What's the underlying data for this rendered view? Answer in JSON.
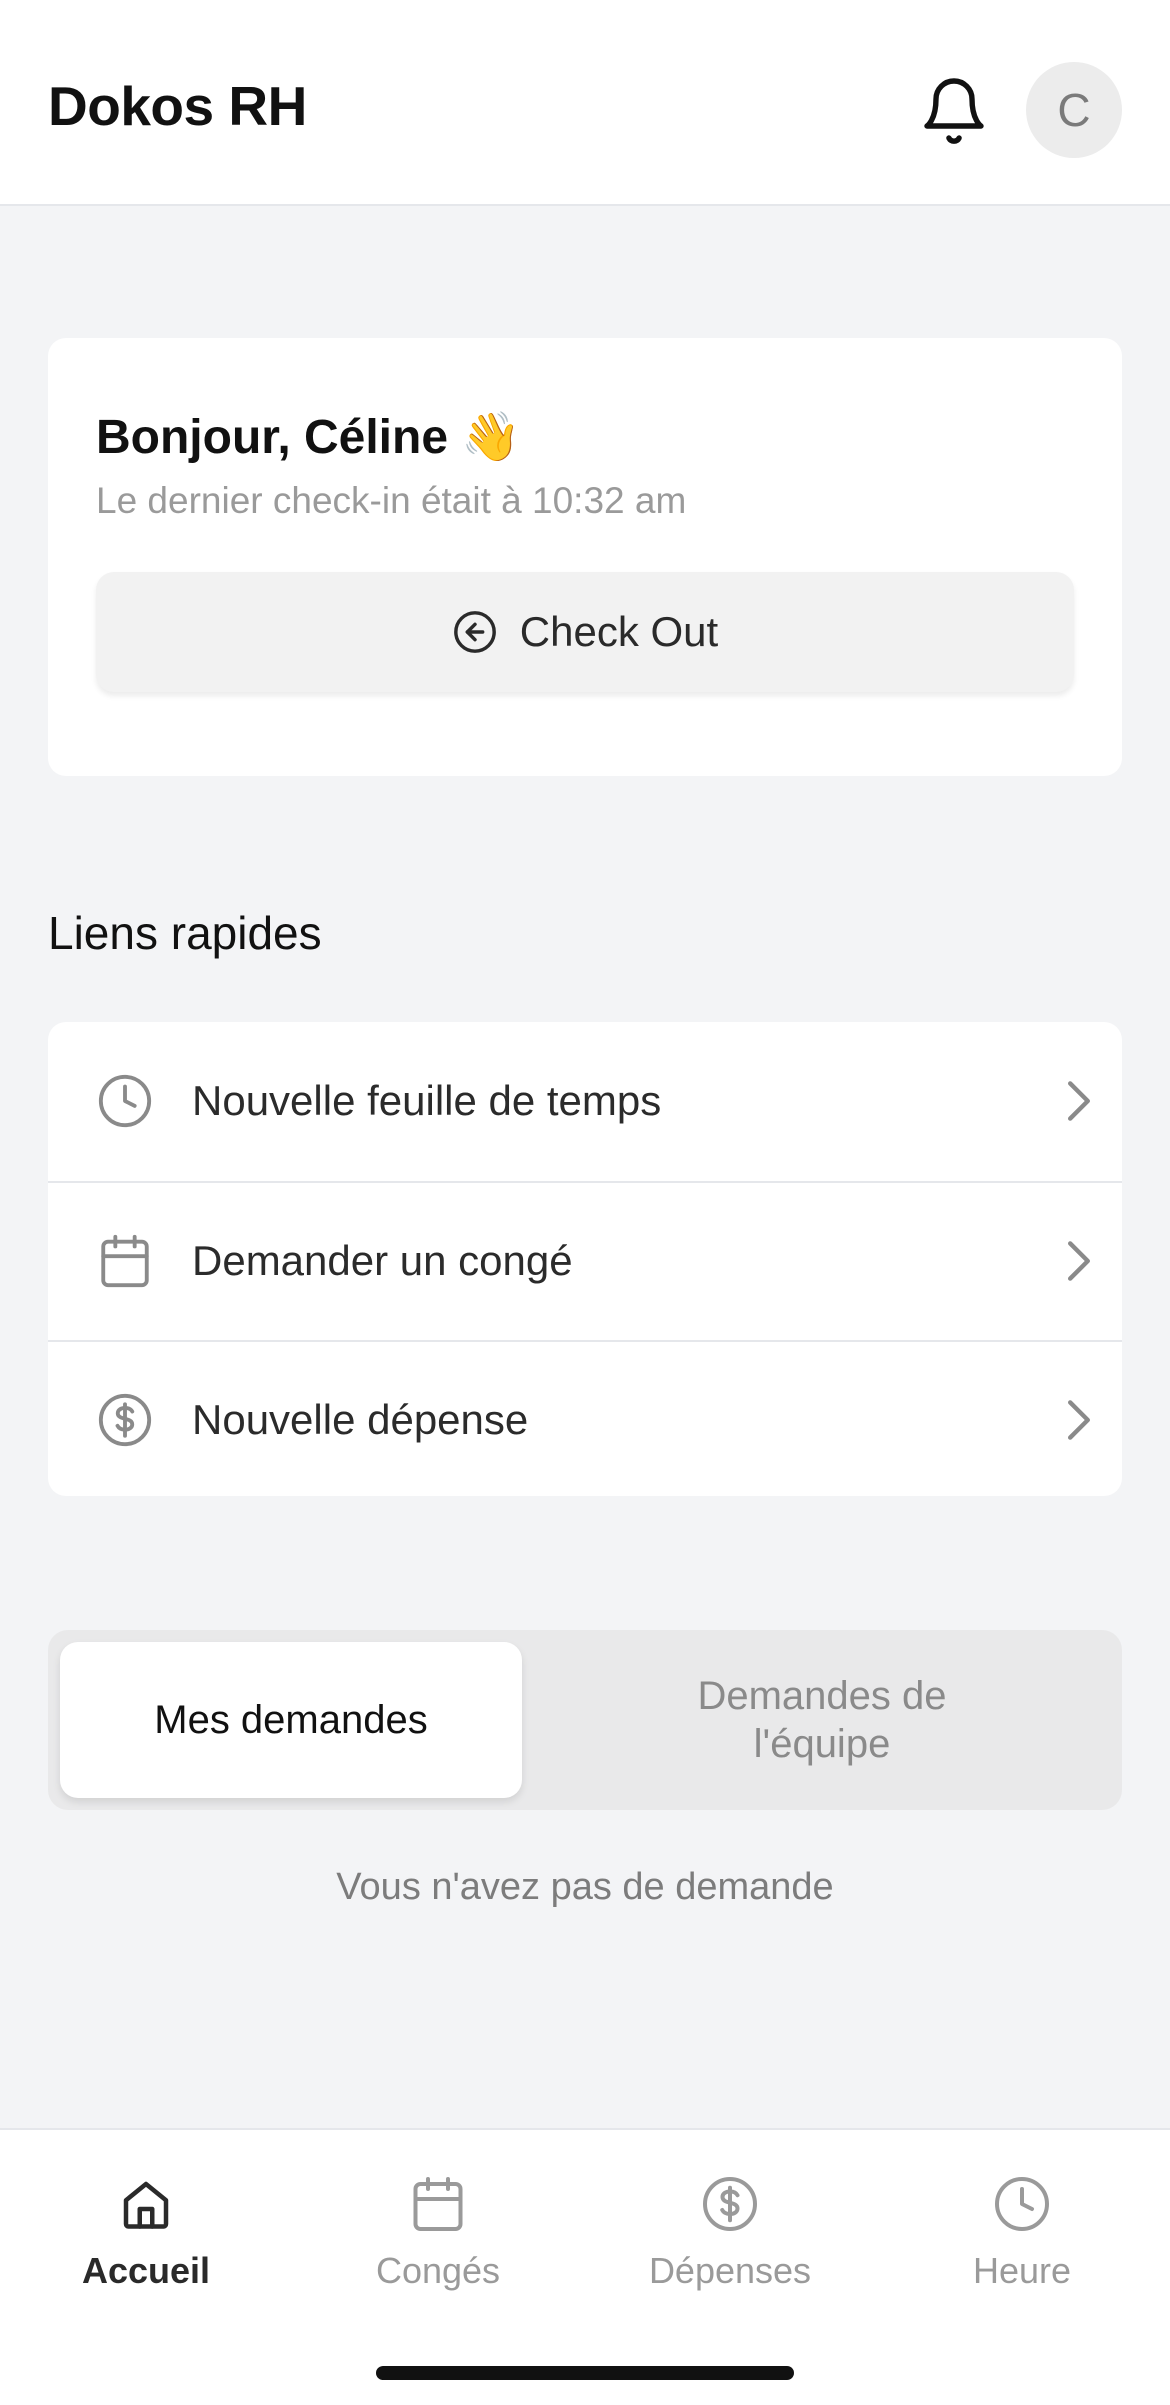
{
  "header": {
    "app_title": "Dokos RH",
    "notifications_icon": "bell-icon",
    "avatar_initial": "C"
  },
  "greeting": {
    "title": "Bonjour, Céline 👋",
    "subtitle": "Le dernier check-in était à 10:32 am",
    "checkout_label": "Check Out",
    "checkout_icon": "arrow-left-circle-icon"
  },
  "quick_links": {
    "title": "Liens rapides",
    "items": [
      {
        "label": "Nouvelle feuille de temps",
        "icon": "clock-icon"
      },
      {
        "label": "Demander un congé",
        "icon": "calendar-icon"
      },
      {
        "label": "Nouvelle dépense",
        "icon": "dollar-circle-icon"
      }
    ]
  },
  "requests": {
    "tabs": [
      {
        "label": "Mes demandes",
        "active": true
      },
      {
        "label": "Demandes de l'équipe",
        "active": false
      }
    ],
    "empty_text": "Vous n'avez pas de demande"
  },
  "bottom_nav": {
    "items": [
      {
        "label": "Accueil",
        "icon": "home-icon",
        "active": true
      },
      {
        "label": "Congés",
        "icon": "calendar-icon",
        "active": false
      },
      {
        "label": "Dépenses",
        "icon": "dollar-circle-icon",
        "active": false
      },
      {
        "label": "Heure",
        "icon": "clock-icon",
        "active": false
      }
    ]
  },
  "colors": {
    "background": "#f3f4f6",
    "card": "#ffffff",
    "text_primary": "#111111",
    "text_muted": "#9a9a9a",
    "segment_bg": "#e9e9ea"
  }
}
